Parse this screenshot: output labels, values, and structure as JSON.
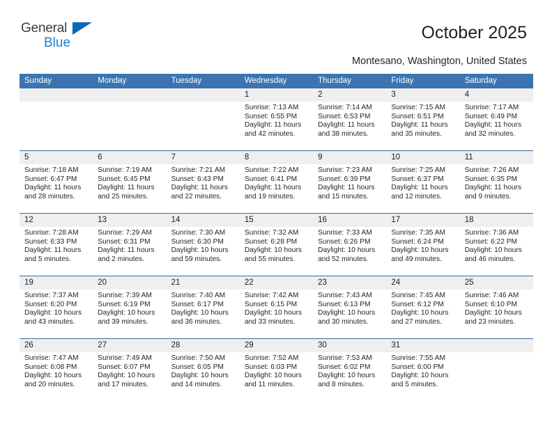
{
  "brand": {
    "name_top": "General",
    "name_bottom": "Blue",
    "triangle_color": "#0a69b5",
    "text_color": "#3b3b3b",
    "blue_text_color": "#1b7fd4"
  },
  "header": {
    "title": "October 2025",
    "subtitle": "Montesano, Washington, United States",
    "accent_color": "#3b74b1",
    "row_border_color": "#2e6da7",
    "daynum_band_color": "#efeff0"
  },
  "calendar": {
    "weekday_headers": [
      "Sunday",
      "Monday",
      "Tuesday",
      "Wednesday",
      "Thursday",
      "Friday",
      "Saturday"
    ],
    "labels": {
      "sunrise": "Sunrise:",
      "sunset": "Sunset:",
      "daylight": "Daylight:"
    },
    "weeks": [
      [
        {
          "day": "",
          "sunrise": "",
          "sunset": "",
          "daylight_line1": "",
          "daylight_line2": ""
        },
        {
          "day": "",
          "sunrise": "",
          "sunset": "",
          "daylight_line1": "",
          "daylight_line2": ""
        },
        {
          "day": "",
          "sunrise": "",
          "sunset": "",
          "daylight_line1": "",
          "daylight_line2": ""
        },
        {
          "day": "1",
          "sunrise": "Sunrise: 7:13 AM",
          "sunset": "Sunset: 6:55 PM",
          "daylight_line1": "Daylight: 11 hours",
          "daylight_line2": "and 42 minutes."
        },
        {
          "day": "2",
          "sunrise": "Sunrise: 7:14 AM",
          "sunset": "Sunset: 6:53 PM",
          "daylight_line1": "Daylight: 11 hours",
          "daylight_line2": "and 38 minutes."
        },
        {
          "day": "3",
          "sunrise": "Sunrise: 7:15 AM",
          "sunset": "Sunset: 6:51 PM",
          "daylight_line1": "Daylight: 11 hours",
          "daylight_line2": "and 35 minutes."
        },
        {
          "day": "4",
          "sunrise": "Sunrise: 7:17 AM",
          "sunset": "Sunset: 6:49 PM",
          "daylight_line1": "Daylight: 11 hours",
          "daylight_line2": "and 32 minutes."
        }
      ],
      [
        {
          "day": "5",
          "sunrise": "Sunrise: 7:18 AM",
          "sunset": "Sunset: 6:47 PM",
          "daylight_line1": "Daylight: 11 hours",
          "daylight_line2": "and 28 minutes."
        },
        {
          "day": "6",
          "sunrise": "Sunrise: 7:19 AM",
          "sunset": "Sunset: 6:45 PM",
          "daylight_line1": "Daylight: 11 hours",
          "daylight_line2": "and 25 minutes."
        },
        {
          "day": "7",
          "sunrise": "Sunrise: 7:21 AM",
          "sunset": "Sunset: 6:43 PM",
          "daylight_line1": "Daylight: 11 hours",
          "daylight_line2": "and 22 minutes."
        },
        {
          "day": "8",
          "sunrise": "Sunrise: 7:22 AM",
          "sunset": "Sunset: 6:41 PM",
          "daylight_line1": "Daylight: 11 hours",
          "daylight_line2": "and 19 minutes."
        },
        {
          "day": "9",
          "sunrise": "Sunrise: 7:23 AM",
          "sunset": "Sunset: 6:39 PM",
          "daylight_line1": "Daylight: 11 hours",
          "daylight_line2": "and 15 minutes."
        },
        {
          "day": "10",
          "sunrise": "Sunrise: 7:25 AM",
          "sunset": "Sunset: 6:37 PM",
          "daylight_line1": "Daylight: 11 hours",
          "daylight_line2": "and 12 minutes."
        },
        {
          "day": "11",
          "sunrise": "Sunrise: 7:26 AM",
          "sunset": "Sunset: 6:35 PM",
          "daylight_line1": "Daylight: 11 hours",
          "daylight_line2": "and 9 minutes."
        }
      ],
      [
        {
          "day": "12",
          "sunrise": "Sunrise: 7:28 AM",
          "sunset": "Sunset: 6:33 PM",
          "daylight_line1": "Daylight: 11 hours",
          "daylight_line2": "and 5 minutes."
        },
        {
          "day": "13",
          "sunrise": "Sunrise: 7:29 AM",
          "sunset": "Sunset: 6:31 PM",
          "daylight_line1": "Daylight: 11 hours",
          "daylight_line2": "and 2 minutes."
        },
        {
          "day": "14",
          "sunrise": "Sunrise: 7:30 AM",
          "sunset": "Sunset: 6:30 PM",
          "daylight_line1": "Daylight: 10 hours",
          "daylight_line2": "and 59 minutes."
        },
        {
          "day": "15",
          "sunrise": "Sunrise: 7:32 AM",
          "sunset": "Sunset: 6:28 PM",
          "daylight_line1": "Daylight: 10 hours",
          "daylight_line2": "and 55 minutes."
        },
        {
          "day": "16",
          "sunrise": "Sunrise: 7:33 AM",
          "sunset": "Sunset: 6:26 PM",
          "daylight_line1": "Daylight: 10 hours",
          "daylight_line2": "and 52 minutes."
        },
        {
          "day": "17",
          "sunrise": "Sunrise: 7:35 AM",
          "sunset": "Sunset: 6:24 PM",
          "daylight_line1": "Daylight: 10 hours",
          "daylight_line2": "and 49 minutes."
        },
        {
          "day": "18",
          "sunrise": "Sunrise: 7:36 AM",
          "sunset": "Sunset: 6:22 PM",
          "daylight_line1": "Daylight: 10 hours",
          "daylight_line2": "and 46 minutes."
        }
      ],
      [
        {
          "day": "19",
          "sunrise": "Sunrise: 7:37 AM",
          "sunset": "Sunset: 6:20 PM",
          "daylight_line1": "Daylight: 10 hours",
          "daylight_line2": "and 43 minutes."
        },
        {
          "day": "20",
          "sunrise": "Sunrise: 7:39 AM",
          "sunset": "Sunset: 6:19 PM",
          "daylight_line1": "Daylight: 10 hours",
          "daylight_line2": "and 39 minutes."
        },
        {
          "day": "21",
          "sunrise": "Sunrise: 7:40 AM",
          "sunset": "Sunset: 6:17 PM",
          "daylight_line1": "Daylight: 10 hours",
          "daylight_line2": "and 36 minutes."
        },
        {
          "day": "22",
          "sunrise": "Sunrise: 7:42 AM",
          "sunset": "Sunset: 6:15 PM",
          "daylight_line1": "Daylight: 10 hours",
          "daylight_line2": "and 33 minutes."
        },
        {
          "day": "23",
          "sunrise": "Sunrise: 7:43 AM",
          "sunset": "Sunset: 6:13 PM",
          "daylight_line1": "Daylight: 10 hours",
          "daylight_line2": "and 30 minutes."
        },
        {
          "day": "24",
          "sunrise": "Sunrise: 7:45 AM",
          "sunset": "Sunset: 6:12 PM",
          "daylight_line1": "Daylight: 10 hours",
          "daylight_line2": "and 27 minutes."
        },
        {
          "day": "25",
          "sunrise": "Sunrise: 7:46 AM",
          "sunset": "Sunset: 6:10 PM",
          "daylight_line1": "Daylight: 10 hours",
          "daylight_line2": "and 23 minutes."
        }
      ],
      [
        {
          "day": "26",
          "sunrise": "Sunrise: 7:47 AM",
          "sunset": "Sunset: 6:08 PM",
          "daylight_line1": "Daylight: 10 hours",
          "daylight_line2": "and 20 minutes."
        },
        {
          "day": "27",
          "sunrise": "Sunrise: 7:49 AM",
          "sunset": "Sunset: 6:07 PM",
          "daylight_line1": "Daylight: 10 hours",
          "daylight_line2": "and 17 minutes."
        },
        {
          "day": "28",
          "sunrise": "Sunrise: 7:50 AM",
          "sunset": "Sunset: 6:05 PM",
          "daylight_line1": "Daylight: 10 hours",
          "daylight_line2": "and 14 minutes."
        },
        {
          "day": "29",
          "sunrise": "Sunrise: 7:52 AM",
          "sunset": "Sunset: 6:03 PM",
          "daylight_line1": "Daylight: 10 hours",
          "daylight_line2": "and 11 minutes."
        },
        {
          "day": "30",
          "sunrise": "Sunrise: 7:53 AM",
          "sunset": "Sunset: 6:02 PM",
          "daylight_line1": "Daylight: 10 hours",
          "daylight_line2": "and 8 minutes."
        },
        {
          "day": "31",
          "sunrise": "Sunrise: 7:55 AM",
          "sunset": "Sunset: 6:00 PM",
          "daylight_line1": "Daylight: 10 hours",
          "daylight_line2": "and 5 minutes."
        },
        {
          "day": "",
          "sunrise": "",
          "sunset": "",
          "daylight_line1": "",
          "daylight_line2": ""
        }
      ]
    ]
  }
}
